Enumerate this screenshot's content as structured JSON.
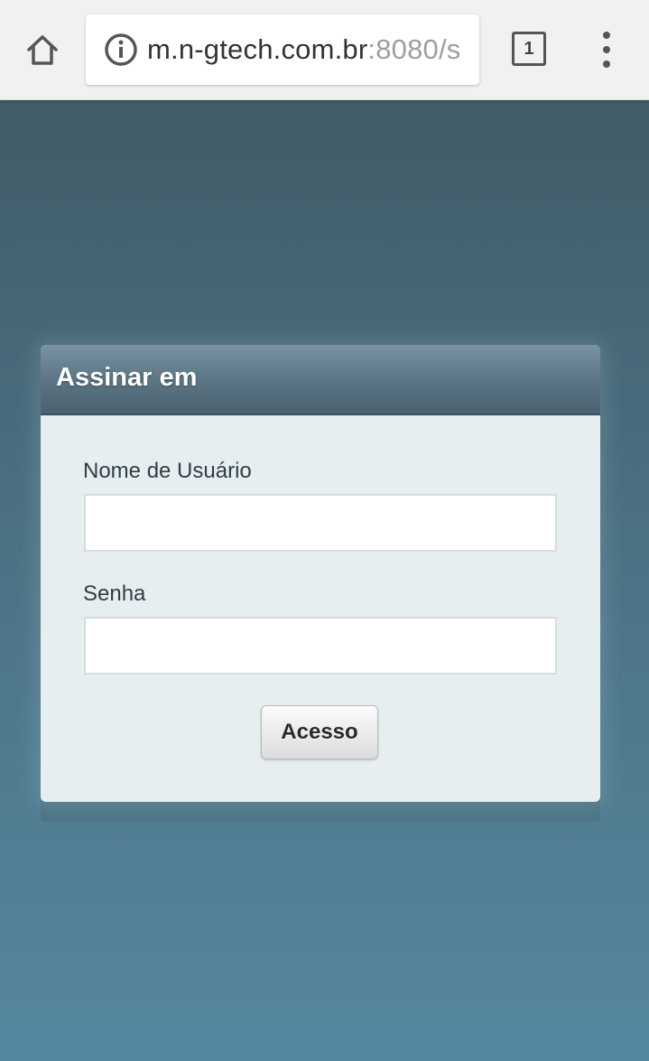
{
  "browser": {
    "url_host": "m.n-gtech.com.br",
    "url_rest": ":8080/s",
    "tab_count": "1",
    "icons": {
      "home": "home-icon",
      "info": "info-icon",
      "tabs": "tab-switcher-icon",
      "menu": "more-vert-icon"
    }
  },
  "login": {
    "title": "Assinar em",
    "username_label": "Nome de Usuário",
    "username_value": "",
    "password_label": "Senha",
    "password_value": "",
    "submit_label": "Acesso"
  },
  "colors": {
    "background_top": "#3f5661",
    "background_bottom": "#5588a0",
    "panel_body": "#e6eef0",
    "panel_header": "#5a7484"
  }
}
